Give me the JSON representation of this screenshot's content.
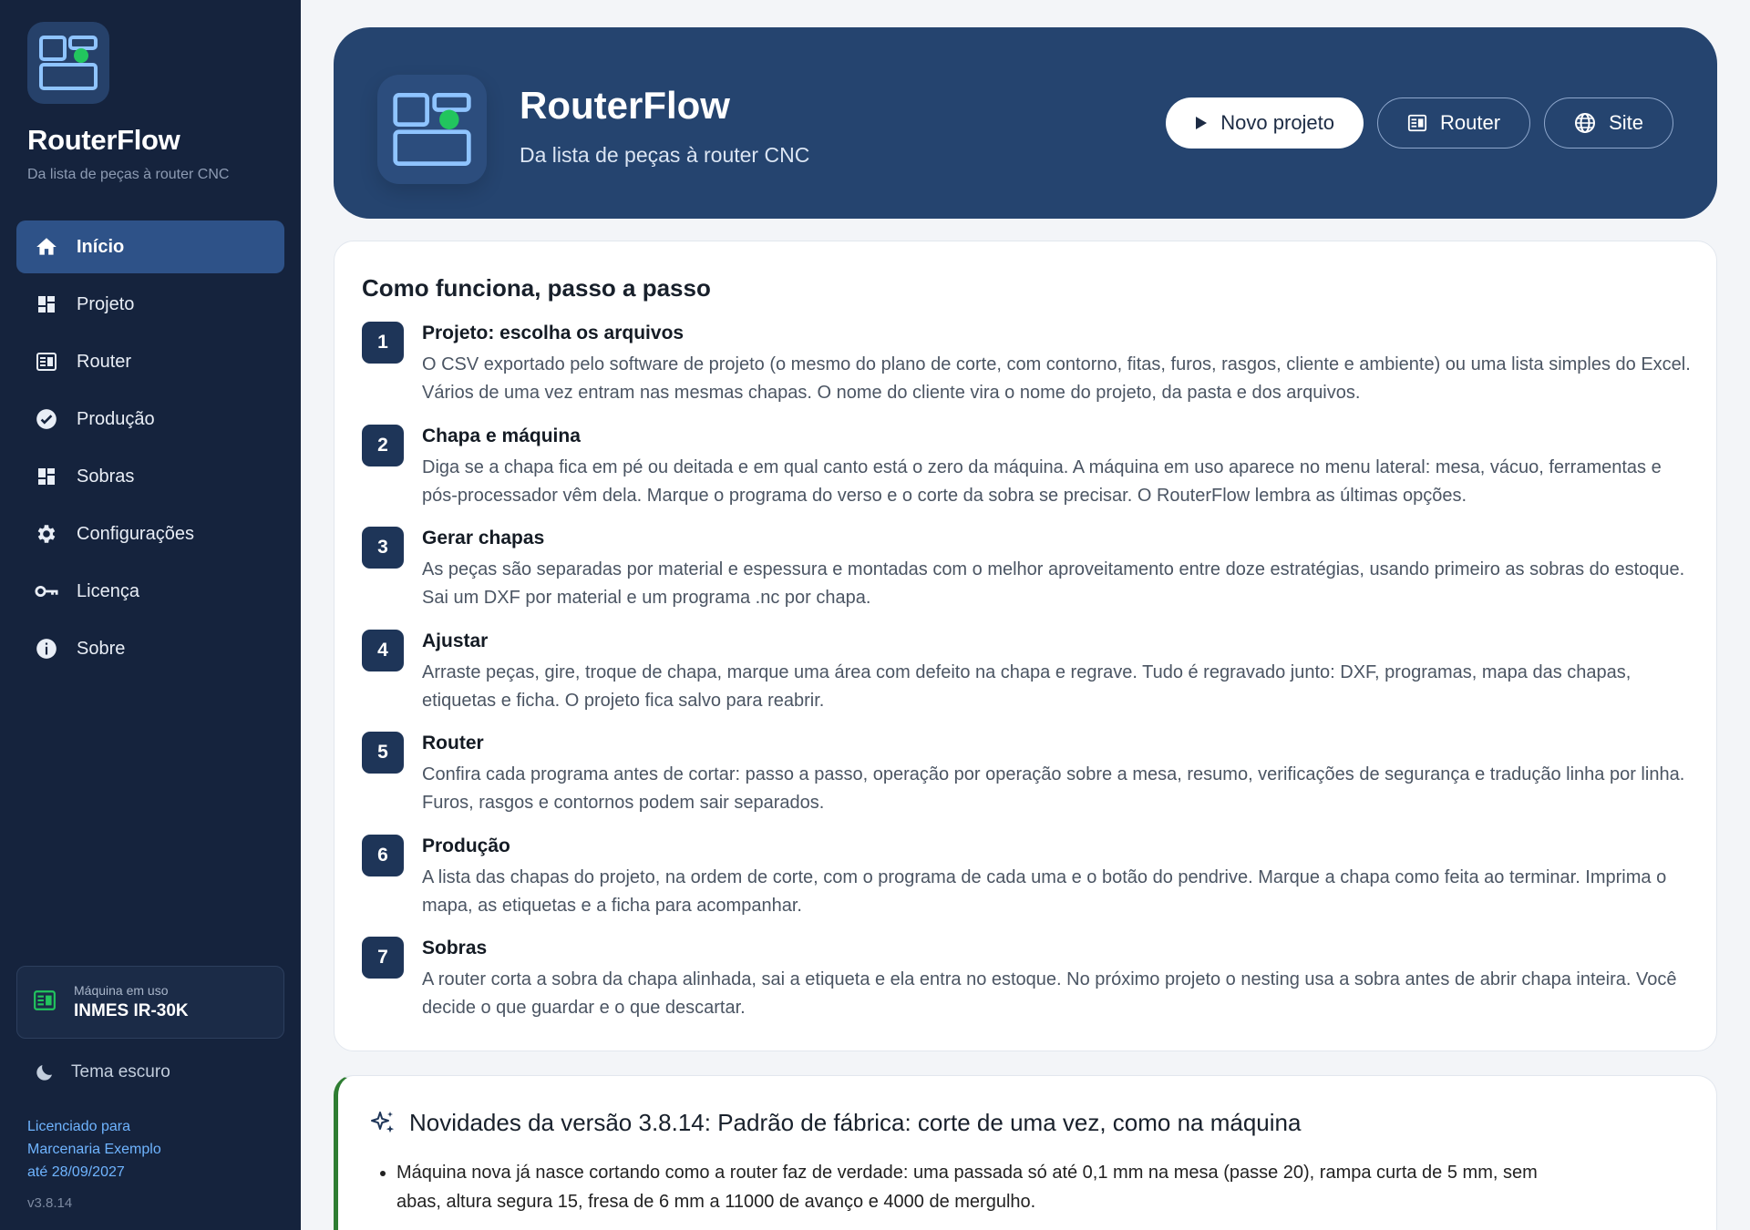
{
  "sidebar": {
    "brand": "RouterFlow",
    "tagline": "Da lista de peças à router CNC",
    "items": [
      {
        "label": "Início",
        "icon": "home-icon",
        "active": true
      },
      {
        "label": "Projeto",
        "icon": "dashboard-icon"
      },
      {
        "label": "Router",
        "icon": "router-icon"
      },
      {
        "label": "Produção",
        "icon": "check-circle-icon"
      },
      {
        "label": "Sobras",
        "icon": "dashboard-icon"
      },
      {
        "label": "Configurações",
        "icon": "gear-icon"
      },
      {
        "label": "Licença",
        "icon": "key-icon"
      },
      {
        "label": "Sobre",
        "icon": "info-icon"
      }
    ],
    "machine": {
      "label": "Máquina em uso",
      "name": "INMES IR-30K"
    },
    "theme_toggle": "Tema escuro",
    "license": {
      "line1": "Licenciado para",
      "line2": "Marcenaria Exemplo",
      "line3": "até 28/09/2027"
    },
    "version": "v3.8.14"
  },
  "header": {
    "title": "RouterFlow",
    "subtitle": "Da lista de peças à router CNC",
    "buttons": {
      "new_project": "Novo projeto",
      "router": "Router",
      "site": "Site"
    }
  },
  "steps": {
    "title": "Como funciona, passo a passo",
    "items": [
      {
        "n": "1",
        "title": "Projeto: escolha os arquivos",
        "text": "O CSV exportado pelo software de projeto (o mesmo do plano de corte, com contorno, fitas, furos, rasgos, cliente e ambiente) ou uma lista simples do Excel. Vários de uma vez entram nas mesmas chapas. O nome do cliente vira o nome do projeto, da pasta e dos arquivos."
      },
      {
        "n": "2",
        "title": "Chapa e máquina",
        "text": "Diga se a chapa fica em pé ou deitada e em qual canto está o zero da máquina. A máquina em uso aparece no menu lateral: mesa, vácuo, ferramentas e pós-processador vêm dela. Marque o programa do verso e o corte da sobra se precisar. O RouterFlow lembra as últimas opções."
      },
      {
        "n": "3",
        "title": "Gerar chapas",
        "text": "As peças são separadas por material e espessura e montadas com o melhor aproveitamento entre doze estratégias, usando primeiro as sobras do estoque. Sai um DXF por material e um programa .nc por chapa."
      },
      {
        "n": "4",
        "title": "Ajustar",
        "text": "Arraste peças, gire, troque de chapa, marque uma área com defeito na chapa e regrave. Tudo é regravado junto: DXF, programas, mapa das chapas, etiquetas e ficha. O projeto fica salvo para reabrir."
      },
      {
        "n": "5",
        "title": "Router",
        "text": "Confira cada programa antes de cortar: passo a passo, operação por operação sobre a mesa, resumo, verificações de segurança e tradução linha por linha. Furos, rasgos e contornos podem sair separados."
      },
      {
        "n": "6",
        "title": "Produção",
        "text": "A lista das chapas do projeto, na ordem de corte, com o programa de cada uma e o botão do pendrive. Marque a chapa como feita ao terminar. Imprima o mapa, as etiquetas e a ficha para acompanhar."
      },
      {
        "n": "7",
        "title": "Sobras",
        "text": "A router corta a sobra da chapa alinhada, sai a etiqueta e ela entra no estoque. No próximo projeto o nesting usa a sobra antes de abrir chapa inteira. Você decide o que guardar e o que descartar."
      }
    ]
  },
  "news": {
    "title": "Novidades da versão 3.8.14: Padrão de fábrica: corte de uma vez, como na máquina",
    "items": [
      "Máquina nova já nasce cortando como a router faz de verdade: uma passada só até 0,1 mm na mesa (passe 20), rampa curta de 5 mm, sem abas, altura segura 15, fresa de 6 mm a 11000 de avanço e 4000 de mergulho."
    ]
  },
  "colors": {
    "sidebar_bg": "#15233d",
    "active_item": "#2e5288",
    "hero_bg": "#25446f",
    "accent_green": "#22c55e",
    "news_border": "#2e7d32"
  }
}
